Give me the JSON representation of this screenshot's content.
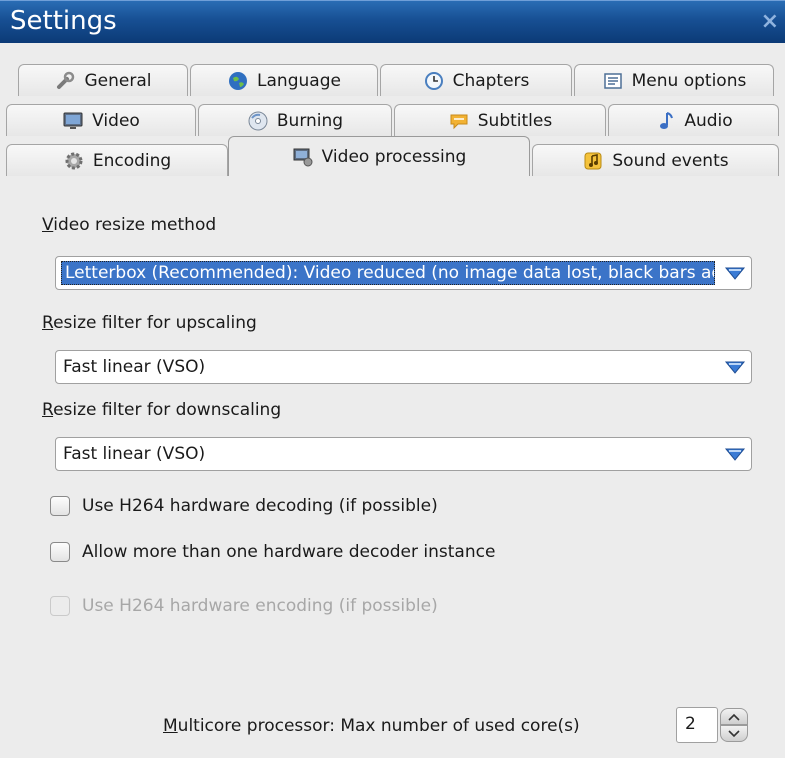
{
  "window": {
    "title": "Settings",
    "close_glyph": "×"
  },
  "tabs": [
    {
      "label": "General",
      "icon": "wrench-icon"
    },
    {
      "label": "Language",
      "icon": "globe-icon"
    },
    {
      "label": "Chapters",
      "icon": "clock-icon"
    },
    {
      "label": "Menu options",
      "icon": "menu-list-icon"
    },
    {
      "label": "Video",
      "icon": "monitor-icon"
    },
    {
      "label": "Burning",
      "icon": "disc-icon"
    },
    {
      "label": "Subtitles",
      "icon": "speech-bubble-icon"
    },
    {
      "label": "Audio",
      "icon": "music-note-icon"
    },
    {
      "label": "Encoding",
      "icon": "gear-icon"
    },
    {
      "label": "Video processing",
      "icon": "video-processing-icon",
      "active": true
    },
    {
      "label": "Sound events",
      "icon": "sound-events-icon"
    }
  ],
  "video_resize": {
    "label_underline": "V",
    "label_rest": "ideo resize method",
    "value": "Letterbox (Recommended): Video reduced (no image data lost, black bars added)"
  },
  "upscale": {
    "label_underline": "R",
    "label_rest": "esize filter for upscaling",
    "value": "Fast linear (VSO)"
  },
  "downscale": {
    "label_underline": "R",
    "label_rest": "esize filter for downscaling",
    "value": "Fast linear (VSO)"
  },
  "checkboxes": [
    {
      "label": "Use H264 hardware decoding (if possible)",
      "checked": false,
      "disabled": false
    },
    {
      "label": "Allow more than one hardware decoder instance",
      "checked": false,
      "disabled": false
    },
    {
      "label": "Use H264 hardware encoding (if possible)",
      "checked": false,
      "disabled": true
    }
  ],
  "multicore": {
    "label_underline": "M",
    "label_rest": "ulticore processor: Max number of used core(s)",
    "value": "2"
  },
  "colors": {
    "title_bar": "#174f93",
    "selection": "#3b74c8",
    "arrow_blue": "#3a7bd5"
  }
}
